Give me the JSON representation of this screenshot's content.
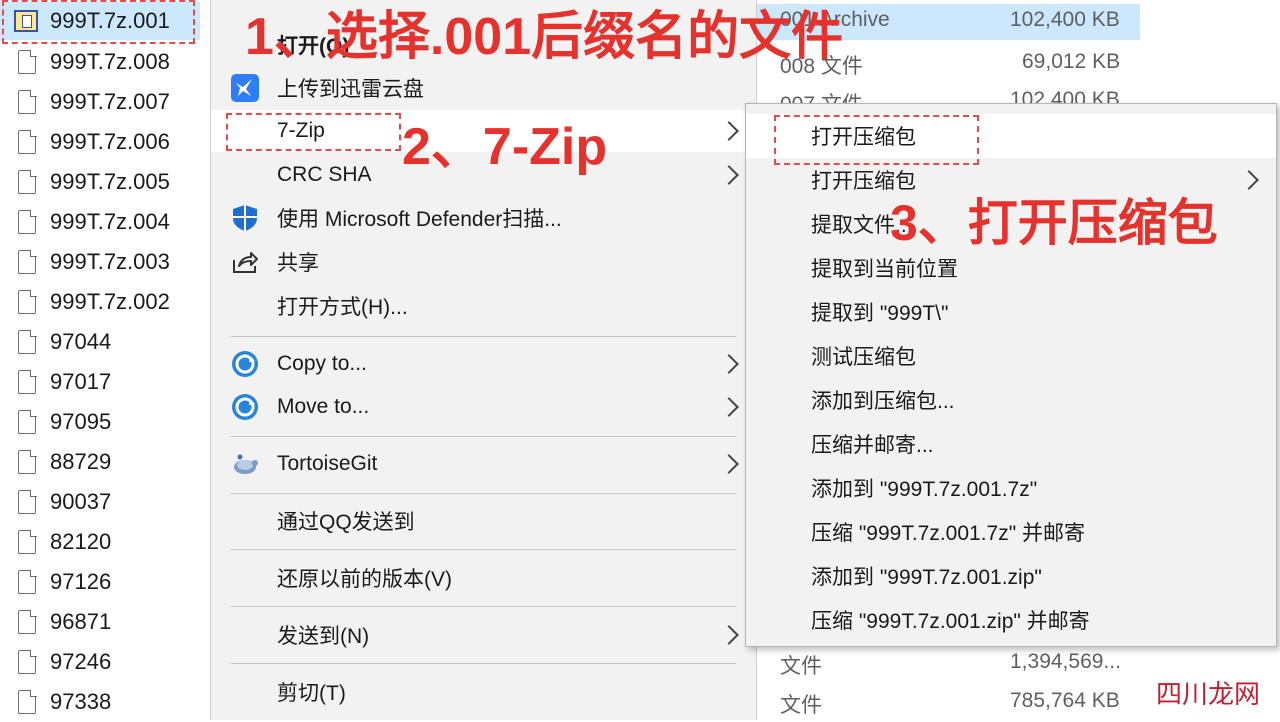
{
  "files": [
    {
      "name": "999T.7z.001",
      "icon": "archive-icon"
    },
    {
      "name": "999T.7z.008",
      "icon": "file-icon"
    },
    {
      "name": "999T.7z.007",
      "icon": "file-icon"
    },
    {
      "name": "999T.7z.006",
      "icon": "file-icon"
    },
    {
      "name": "999T.7z.005",
      "icon": "file-icon"
    },
    {
      "name": "999T.7z.004",
      "icon": "file-icon"
    },
    {
      "name": "999T.7z.003",
      "icon": "file-icon"
    },
    {
      "name": "999T.7z.002",
      "icon": "file-icon"
    },
    {
      "name": "97044",
      "icon": "file-icon"
    },
    {
      "name": "97017",
      "icon": "file-icon"
    },
    {
      "name": "97095",
      "icon": "file-icon"
    },
    {
      "name": "88729",
      "icon": "file-icon"
    },
    {
      "name": "90037",
      "icon": "file-icon"
    },
    {
      "name": "82120",
      "icon": "file-icon"
    },
    {
      "name": "97126",
      "icon": "file-icon"
    },
    {
      "name": "96871",
      "icon": "file-icon"
    },
    {
      "name": "97246",
      "icon": "file-icon"
    },
    {
      "name": "97338",
      "icon": "file-icon"
    }
  ],
  "background_columns": {
    "types": [
      "001 Archive",
      "008 文件",
      "007 文件",
      "文件",
      "文件"
    ],
    "sizes": [
      "102,400 KB",
      "69,012 KB",
      "102,400 KB",
      "1,394,569...",
      "785,764 KB"
    ]
  },
  "context_menu": {
    "items": [
      {
        "label": "打开(O)",
        "icon": "",
        "chevron": false
      },
      {
        "label": "上传到迅雷云盘",
        "icon": "thunder-bird-icon",
        "chevron": false
      },
      {
        "label": "7-Zip",
        "icon": "",
        "chevron": true
      },
      {
        "label": "CRC SHA",
        "icon": "",
        "chevron": true
      },
      {
        "label": "使用 Microsoft Defender扫描...",
        "icon": "defender-shield-icon",
        "chevron": false
      },
      {
        "label": "共享",
        "icon": "share-icon",
        "chevron": false
      },
      {
        "label": "打开方式(H)...",
        "icon": "",
        "chevron": false
      },
      {
        "label": "Copy to...",
        "icon": "copy-to-icon",
        "chevron": true
      },
      {
        "label": "Move to...",
        "icon": "move-to-icon",
        "chevron": true
      },
      {
        "label": "TortoiseGit",
        "icon": "tortoisegit-icon",
        "chevron": true
      },
      {
        "label": "通过QQ发送到",
        "icon": "",
        "chevron": false
      },
      {
        "label": "还原以前的版本(V)",
        "icon": "",
        "chevron": false
      },
      {
        "label": "发送到(N)",
        "icon": "",
        "chevron": true
      },
      {
        "label": "剪切(T)",
        "icon": "",
        "chevron": false
      }
    ]
  },
  "submenu": {
    "items": [
      {
        "label": "打开压缩包",
        "chevron": false
      },
      {
        "label": "打开压缩包",
        "chevron": true
      },
      {
        "label": "提取文件...",
        "chevron": false
      },
      {
        "label": "提取到当前位置",
        "chevron": false
      },
      {
        "label": "提取到 \"999T\\\"",
        "chevron": false
      },
      {
        "label": "测试压缩包",
        "chevron": false
      },
      {
        "label": "添加到压缩包...",
        "chevron": false
      },
      {
        "label": "压缩并邮寄...",
        "chevron": false
      },
      {
        "label": "添加到 \"999T.7z.001.7z\"",
        "chevron": false
      },
      {
        "label": "压缩 \"999T.7z.001.7z\" 并邮寄",
        "chevron": false
      },
      {
        "label": "添加到 \"999T.7z.001.zip\"",
        "chevron": false
      },
      {
        "label": "压缩 \"999T.7z.001.zip\" 并邮寄",
        "chevron": false
      }
    ]
  },
  "annotations": {
    "step1": "1、选择.001后缀名的文件",
    "step2": "2、7-Zip",
    "step3": "3、打开压缩包"
  },
  "watermark": "四川龙网",
  "colors": {
    "annotation": "#e5322d",
    "selection": "#cce8ff",
    "menu_bg": "#f2f2f2"
  }
}
